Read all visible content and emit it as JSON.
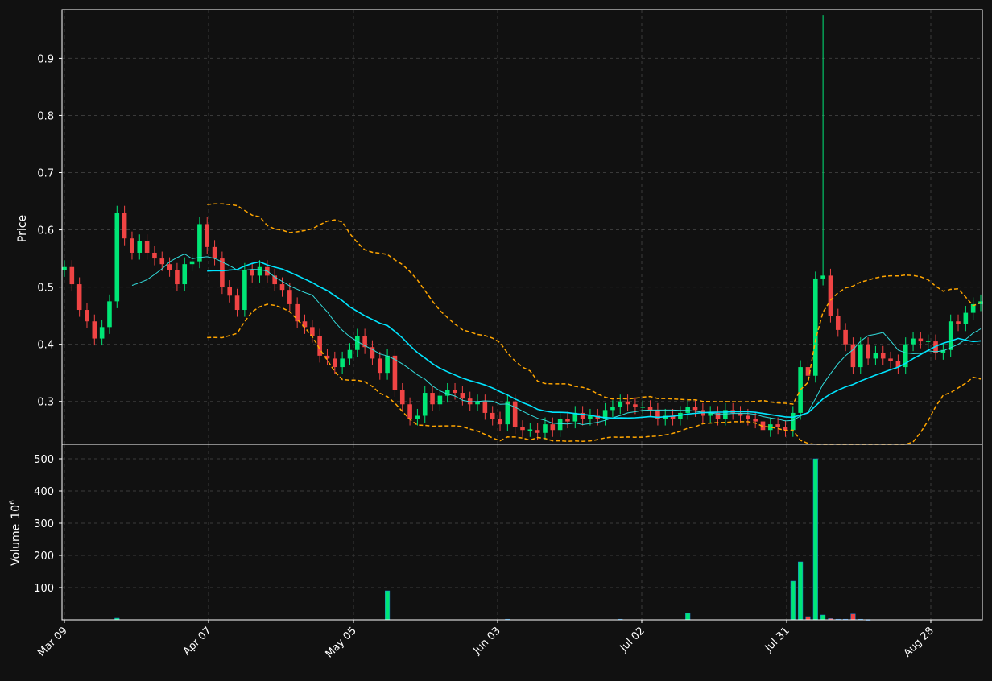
{
  "colors": {
    "background": "#111111",
    "axis": "#ffffff",
    "grid": "#3a3a3a",
    "up": "#00e676",
    "down": "#ef4444",
    "ma_fast": "#33dddd",
    "ma_slow": "#00e5ff",
    "band": "#ffa500",
    "text": "#ffffff"
  },
  "chart_data": [
    {
      "type": "candlestick",
      "panel": "price",
      "ylabel": "Price",
      "ylim": [
        0.225,
        0.985
      ],
      "yticks": [
        0.3,
        0.4,
        0.5,
        0.6,
        0.7,
        0.8,
        0.9
      ],
      "ytick_labels": [
        "0.3",
        "0.4",
        "0.5",
        "0.6",
        "0.7",
        "0.8",
        "0.9"
      ],
      "grid": true,
      "x_range": [
        "Mar 09",
        "Sep 05"
      ],
      "xtick_labels": [
        "Mar 09",
        "Apr 07",
        "May 05",
        "Jun 03",
        "Jul 02",
        "Jul 31",
        "Aug 28"
      ],
      "close": [
        0.535,
        0.505,
        0.46,
        0.44,
        0.41,
        0.43,
        0.475,
        0.63,
        0.585,
        0.56,
        0.58,
        0.56,
        0.55,
        0.54,
        0.53,
        0.505,
        0.54,
        0.545,
        0.61,
        0.57,
        0.55,
        0.5,
        0.485,
        0.46,
        0.53,
        0.52,
        0.535,
        0.52,
        0.505,
        0.495,
        0.47,
        0.44,
        0.43,
        0.415,
        0.38,
        0.375,
        0.36,
        0.375,
        0.39,
        0.415,
        0.395,
        0.375,
        0.35,
        0.38,
        0.32,
        0.295,
        0.27,
        0.275,
        0.315,
        0.295,
        0.31,
        0.32,
        0.315,
        0.305,
        0.295,
        0.3,
        0.28,
        0.27,
        0.26,
        0.3,
        0.255,
        0.25,
        0.25,
        0.245,
        0.26,
        0.25,
        0.27,
        0.265,
        0.28,
        0.27,
        0.275,
        0.27,
        0.285,
        0.29,
        0.3,
        0.295,
        0.29,
        0.29,
        0.285,
        0.27,
        0.275,
        0.27,
        0.28,
        0.29,
        0.285,
        0.275,
        0.28,
        0.27,
        0.285,
        0.28,
        0.275,
        0.27,
        0.265,
        0.25,
        0.26,
        0.255,
        0.25,
        0.28,
        0.36,
        0.345,
        0.515,
        0.52,
        0.45,
        0.425,
        0.4,
        0.36,
        0.4,
        0.375,
        0.385,
        0.375,
        0.37,
        0.36,
        0.4,
        0.41,
        0.405,
        0.405,
        0.385,
        0.39,
        0.44,
        0.435,
        0.455,
        0.47,
        0.475
      ],
      "volume_millions": [
        0,
        0,
        0,
        0,
        0,
        0,
        0,
        5,
        0,
        0,
        0,
        0,
        0,
        0,
        0,
        0,
        0,
        0,
        0,
        0,
        0,
        0,
        0,
        0,
        0,
        0,
        0,
        0,
        0,
        0,
        0,
        0,
        0,
        0,
        0,
        0,
        0,
        0,
        0,
        0,
        0,
        0,
        0,
        90,
        0,
        0,
        0,
        0,
        0,
        0,
        0,
        0,
        0,
        0,
        0,
        0,
        0,
        0,
        0,
        2,
        0,
        0,
        0,
        0,
        0,
        0,
        0,
        0,
        0,
        0,
        0,
        0,
        0,
        0,
        2,
        0,
        0,
        0,
        0,
        0,
        0,
        0,
        0,
        20,
        0,
        0,
        0,
        0,
        0,
        0,
        0,
        0,
        0,
        0,
        0,
        0,
        0,
        120,
        180,
        10,
        500,
        15,
        4,
        2,
        2,
        18,
        2,
        1,
        0,
        0,
        0,
        0,
        0,
        0,
        0,
        0,
        0,
        0,
        0,
        0,
        0,
        0,
        0
      ],
      "series": [
        {
          "key": "ma_fast",
          "style": "solid thin"
        },
        {
          "key": "ma_slow",
          "style": "solid"
        },
        {
          "key": "bollinger_upper",
          "style": "dashed"
        },
        {
          "key": "bollinger_lower",
          "style": "dashed"
        }
      ]
    },
    {
      "type": "bar",
      "panel": "volume",
      "ylabel": "Volume",
      "ylabel_exponent": "10",
      "ylabel_power": "6",
      "ylim": [
        0,
        500
      ],
      "yticks": [
        100,
        200,
        300,
        400,
        500
      ],
      "ytick_labels": [
        "100",
        "200",
        "300",
        "400",
        "500"
      ],
      "grid": true
    }
  ]
}
